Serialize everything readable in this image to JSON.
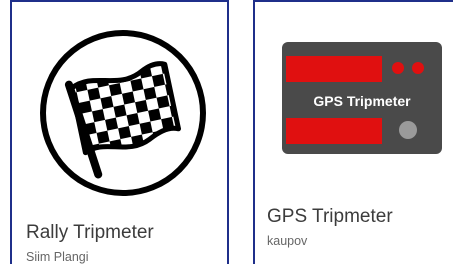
{
  "apps": [
    {
      "title": "Rally Tripmeter",
      "developer": "Siim Plangi",
      "icon": "checkered-flag-icon"
    },
    {
      "title": "GPS Tripmeter",
      "developer": "kaupov",
      "icon": "gps-tripmeter-device-icon",
      "icon_text": "GPS Tripmeter"
    }
  ],
  "colors": {
    "card_border": "#1f2f8a",
    "title_text": "#3c3c3c",
    "developer_text": "#666666",
    "device_body": "#4a4a4a",
    "device_display": "#e01010"
  }
}
